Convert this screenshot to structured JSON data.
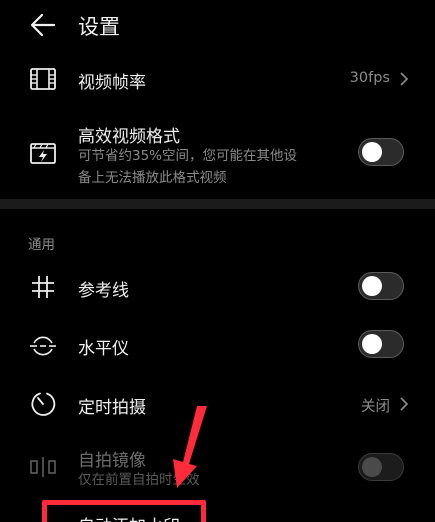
{
  "header": {
    "title": "设置",
    "back_icon": "back-arrow-icon"
  },
  "rows": {
    "frame_rate": {
      "label": "视频帧率",
      "value": "30fps",
      "icon": "film-icon"
    },
    "efficient_format": {
      "label": "高效视频格式",
      "sub_line1": "可节省约35%空间，您可能在其他设",
      "sub_line2": "备上无法播放此格式视频",
      "icon": "hevc-format-icon",
      "toggle": "off"
    }
  },
  "section": {
    "title": "通用"
  },
  "general": {
    "grid": {
      "label": "参考线",
      "icon": "grid-icon",
      "toggle": "off"
    },
    "level": {
      "label": "水平仪",
      "icon": "level-icon",
      "toggle": "off"
    },
    "timer": {
      "label": "定时拍摄",
      "value": "关闭",
      "icon": "timer-icon"
    },
    "mirror": {
      "label": "自拍镜像",
      "sub": "仅在前置自拍时生效",
      "icon": "mirror-icon",
      "toggle": "off",
      "enabled": false
    },
    "watermark": {
      "label": "自动添加水印"
    }
  },
  "colors": {
    "background": "#000000",
    "highlight": "#ff2a3a",
    "annotation_arrow": "#ff2a3a"
  }
}
